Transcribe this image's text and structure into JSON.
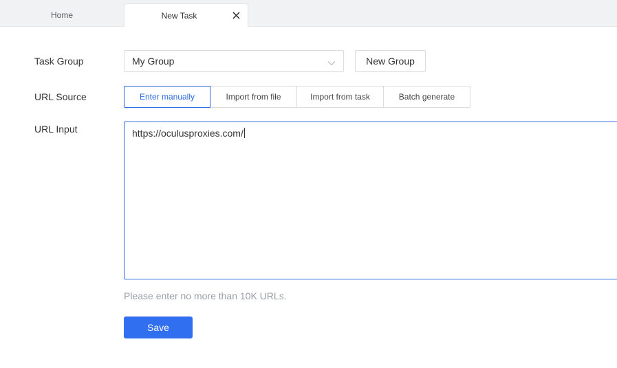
{
  "tabs": [
    {
      "label": "Home",
      "active": false
    },
    {
      "label": "New Task",
      "active": true
    }
  ],
  "form": {
    "task_group": {
      "label": "Task Group",
      "selected": "My Group",
      "new_group_button": "New Group"
    },
    "url_source": {
      "label": "URL Source",
      "options": [
        "Enter manually",
        "Import from file",
        "Import from task",
        "Batch generate"
      ],
      "selected": "Enter manually"
    },
    "url_input": {
      "label": "URL Input",
      "value": "https://oculusproxies.com/",
      "hint": "Please enter no more than 10K URLs."
    },
    "save_button": "Save"
  },
  "colors": {
    "accent": "#2f6ff0",
    "active_border": "#2c6ae0",
    "hint_text": "#999ea6",
    "tabbar_bg": "#f1f2f4"
  },
  "icons": {
    "tab_close": "close-icon",
    "select_arrow": "chevron-down-icon"
  }
}
